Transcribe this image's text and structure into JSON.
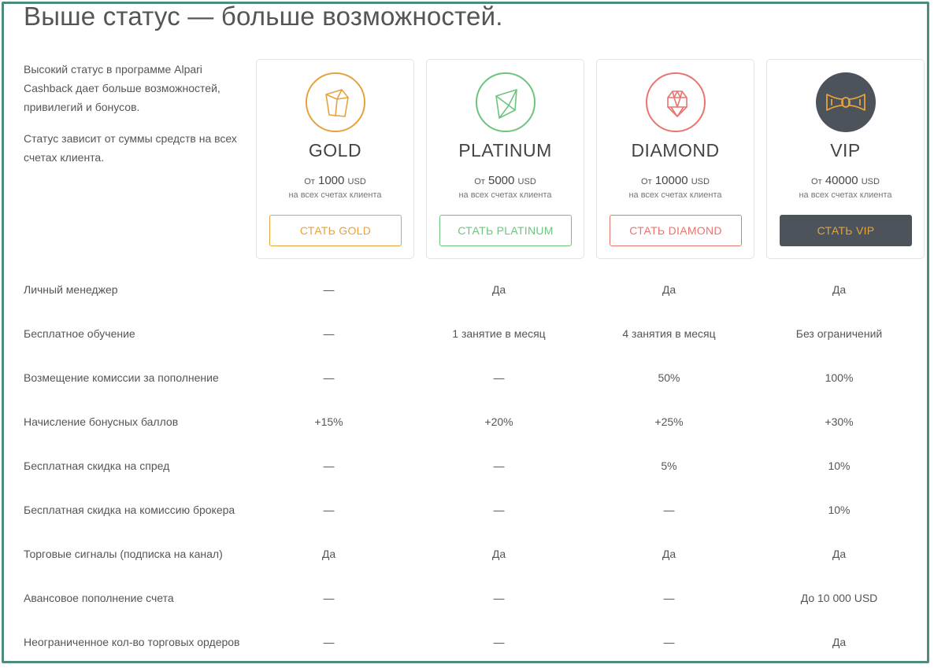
{
  "page": {
    "title": "Выше статус — больше возможностей.",
    "intro": [
      "Высокий статус в программе Alpari Cashback дает больше возможностей, привилегий и бонусов.",
      "Статус зависит от суммы средств на всех счетах клиента."
    ]
  },
  "colors": {
    "gold": "#e6a23c",
    "platinum": "#6cc47e",
    "diamond": "#ea7470",
    "vip_bg": "#4d535b",
    "vip_text": "#e6a23c",
    "frame": "#4e8a7e"
  },
  "tiers": [
    {
      "name": "GOLD",
      "icon": "gold-crystal-icon",
      "prefix": "От",
      "amount": "1000",
      "currency": "USD",
      "sub": "на всех счетах клиента",
      "button": "СТАТЬ GOLD"
    },
    {
      "name": "PLATINUM",
      "icon": "platinum-gem-icon",
      "prefix": "От",
      "amount": "5000",
      "currency": "USD",
      "sub": "на всех счетах клиента",
      "button": "СТАТЬ PLATINUM"
    },
    {
      "name": "DIAMOND",
      "icon": "diamond-icon",
      "prefix": "От",
      "amount": "10000",
      "currency": "USD",
      "sub": "на всех счетах клиента",
      "button": "СТАТЬ DIAMOND"
    },
    {
      "name": "VIP",
      "icon": "bow-tie-icon",
      "prefix": "От",
      "amount": "40000",
      "currency": "USD",
      "sub": "на всех счетах клиента",
      "button": "СТАТЬ VIP"
    }
  ],
  "features": [
    {
      "label": "Личный менеджер",
      "values": [
        "—",
        "Да",
        "Да",
        "Да"
      ]
    },
    {
      "label": "Бесплатное обучение",
      "values": [
        "—",
        "1 занятие в месяц",
        "4 занятия в месяц",
        "Без ограничений"
      ]
    },
    {
      "label": "Возмещение комиссии за пополнение",
      "values": [
        "—",
        "—",
        "50%",
        "100%"
      ]
    },
    {
      "label": "Начисление бонусных баллов",
      "values": [
        "+15%",
        "+20%",
        "+25%",
        "+30%"
      ]
    },
    {
      "label": "Бесплатная скидка на спред",
      "values": [
        "—",
        "—",
        "5%",
        "10%"
      ]
    },
    {
      "label": "Бесплатная скидка на комиссию брокера",
      "values": [
        "—",
        "—",
        "—",
        "10%"
      ]
    },
    {
      "label": "Торговые сигналы (подписка на канал)",
      "values": [
        "Да",
        "Да",
        "Да",
        "Да"
      ]
    },
    {
      "label": "Авансовое пополнение счета",
      "values": [
        "—",
        "—",
        "—",
        "До 10 000 USD"
      ]
    },
    {
      "label": "Неограниченное кол-во торговых ордеров",
      "values": [
        "—",
        "—",
        "—",
        "Да"
      ]
    }
  ]
}
